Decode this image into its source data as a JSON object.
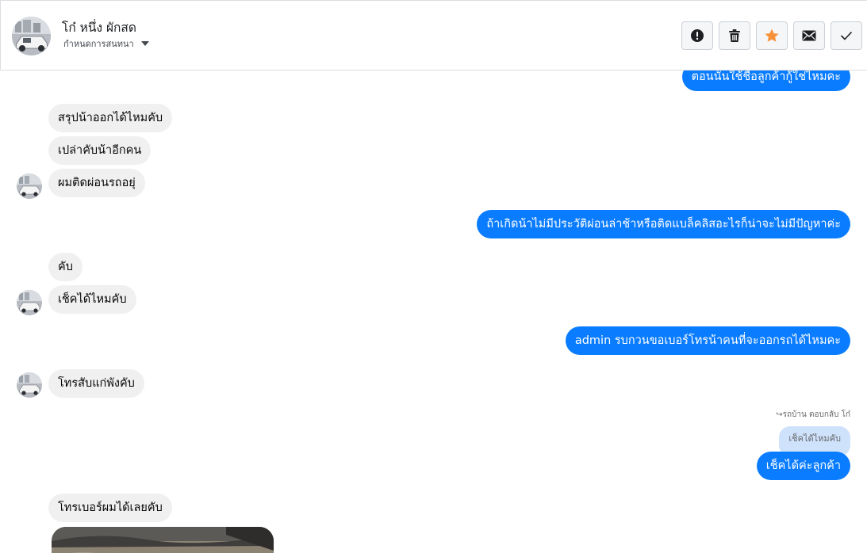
{
  "header": {
    "name": "โก๋ หนึ่ง ผักสด",
    "subtitle": "กำหนดการสนทนา",
    "actions": [
      "report-icon",
      "delete-icon",
      "star-icon",
      "mail-icon",
      "check-icon"
    ],
    "star_color": "#f7923a"
  },
  "colors": {
    "incoming": "#f0f0f0",
    "outgoing": "#0a7cff",
    "reply_quote": "#cfe2fb"
  },
  "messages": {
    "m0": "ตอนนั้นใช้ชื่อลูกค้ากู้ใช่ไหมคะ",
    "m1": "สรุปน้าออกได้ไหมคับ",
    "m2": "เปล่าคับน้าอีกคน",
    "m3": "ผมติดผ่อนรถอยุ่",
    "m4": "ถ้าเกิดน้าไม่มีประวัติผ่อนล่าช้าหรือติดแบล็คลิสอะไรก็น่าจะไม่มีปัญหาค่ะ",
    "m5": "คับ",
    "m6": "เช็คได้ไหมคับ",
    "m7": "admin รบกวนขอเบอร์โทรน้าคนที่จะออกรถได้ไหมคะ",
    "m8": "โทรสับแก่พังคับ",
    "reply_meta": "รถบ้าน ตอบกลับ โก๋",
    "reply_quote": "เช็คได้ไหมคับ",
    "m9": "เช็คได้ค่ะลูกค้า",
    "m10": "โทรเบอร์ผมได้เลยคับ"
  }
}
